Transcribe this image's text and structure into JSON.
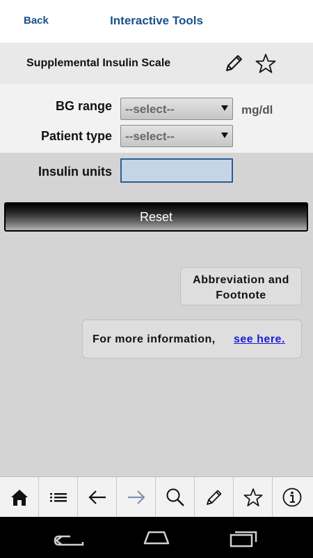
{
  "topbar": {
    "back_label": "Back",
    "title": "Interactive Tools"
  },
  "tool": {
    "title": "Supplemental Insulin Scale",
    "edit_icon": "pencil-icon",
    "favorite_icon": "star-icon"
  },
  "form": {
    "bg_range": {
      "label": "BG range",
      "selected": "--select--",
      "unit": "mg/dl"
    },
    "patient_type": {
      "label": "Patient type",
      "selected": "--select--"
    },
    "insulin_units": {
      "label": "Insulin units",
      "value": ""
    },
    "reset_label": "Reset"
  },
  "abbreviation_button": {
    "line1": "Abbreviation and",
    "line2": "Footnote"
  },
  "more_info": {
    "text": "For more information,",
    "link": "see here."
  },
  "toolbar": {
    "icons": [
      "home-icon",
      "list-icon",
      "back-arrow-icon",
      "forward-arrow-icon",
      "search-icon",
      "pencil-icon",
      "star-icon",
      "info-icon"
    ]
  },
  "android_nav": {
    "icons": [
      "nav-back-icon",
      "nav-home-icon",
      "nav-recents-icon"
    ]
  },
  "colors": {
    "brand_blue": "#1a4f8b",
    "link_blue": "#1a1ad9",
    "input_fill": "#c5d5e6",
    "background": "#d4d4d4"
  }
}
